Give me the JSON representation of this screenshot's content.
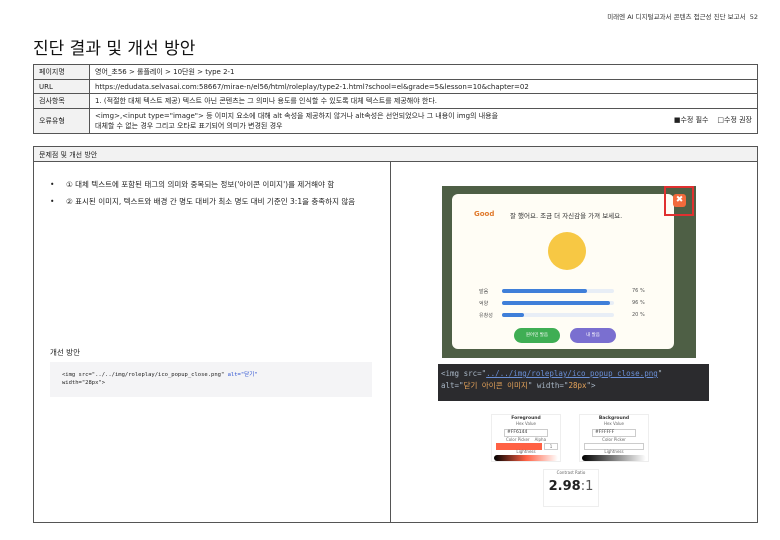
{
  "header": {
    "report_title": "미래엔 AI 디지털교과서 콘텐츠 접근성 진단 보고서",
    "page_number": "52"
  },
  "title": "진단 결과 및 개선 방안",
  "info": [
    {
      "key": "페이지명",
      "value": "영어_초56 > 롤플레이 > 10단원 > type 2-1"
    },
    {
      "key": "URL",
      "value": "https://edudata.selvasai.com:58667/mirae-n/el56/html/roleplay/type2-1.html?school=el&grade=5&lesson=10&chapter=02"
    },
    {
      "key": "검사항목",
      "value": "1. (적절한 대체 텍스트 제공) 텍스트 아닌 콘텐츠는 그 의미나 용도를 인식할 수 있도록 대체 텍스트를 제공해야 한다."
    },
    {
      "key": "오류유형",
      "value_line1": "<img>,<input type=\"image\"> 등 이미지 요소에 대해 alt 속성을 제공하지 않거나 alt속성은 선언되었으나 그 내용이 img의 내용을",
      "value_line2": "대체할 수 없는 경우 그리고 오타로 표기되어 의미가 변경된 경우",
      "legend_required": "■수정 필수",
      "legend_recommended": "□수정 권장"
    }
  ],
  "section": {
    "header": "문제점 및 개선 방안",
    "issues": [
      "① 대체 텍스트에 포함된 태그의 의미와 중복되는 정보('아이콘 이미지')를 제거해야 함",
      "② 표시된 이미지, 텍스트와 배경 간 명도 대비가 최소 명도 대비 기준인 3:1을 충족하지 않음"
    ],
    "fix_label": "개선 방안",
    "fix_code": {
      "pre": "<img src=\"../../img/roleplay/ico_popup_close.png\" ",
      "alt": "alt=\"닫기\"",
      "post": "width=\"28px\">"
    }
  },
  "screenshot": {
    "good": "Good",
    "message": "잘 했어요. 조금 더 자신감을 가져 보세요.",
    "bars": [
      {
        "label": "발음",
        "value": 76,
        "pct": "76 %"
      },
      {
        "label": "억양",
        "value": 96,
        "pct": "96 %"
      },
      {
        "label": "유창성",
        "value": 20,
        "pct": "20 %"
      }
    ],
    "btn1": "원어민 발음",
    "btn2": "내 발음",
    "close_glyph": "✖"
  },
  "current_code": {
    "l1a": "<img src=\"",
    "l1b": "../../img/roleplay/ico_popup_close.png",
    "l1c": "\"",
    "l2a": "alt=\"",
    "l2b": "닫기 아이콘 이미지",
    "l2c": "\" width=\"",
    "l2d": "28px",
    "l2e": "\">"
  },
  "contrast": {
    "fg_title": "Foreground",
    "bg_title": "Background",
    "hex_label": "Hex Value",
    "picker_label": "Color Picker",
    "alpha_label": "Alpha",
    "lightness_label": "Lightness",
    "fg_hex": "#FF6144",
    "bg_hex": "#FFFFFF",
    "fg_color": "#FF6144",
    "bg_color": "#FFFFFF",
    "alpha": "1",
    "ratio_label": "Contrast Ratio",
    "ratio_value": "2.98",
    "ratio_suffix": ":1"
  }
}
